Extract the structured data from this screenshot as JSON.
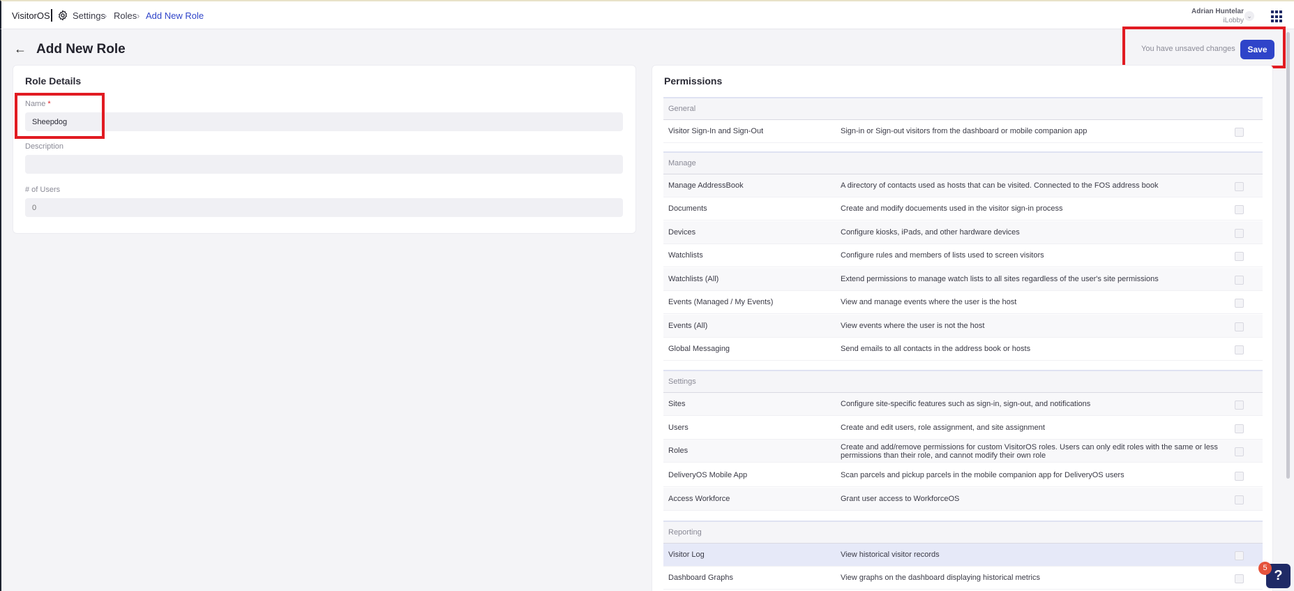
{
  "topbar": {
    "brand": "VisitorOS",
    "breadcrumb": [
      "Settings",
      "Roles",
      "Add New Role"
    ],
    "chevron": "›",
    "user_name": "Adrian Huntelar",
    "user_org": "iLobby"
  },
  "header": {
    "title": "Add New Role",
    "back_icon": "←",
    "unsaved_text": "You have unsaved changes",
    "save_label": "Save"
  },
  "role_details": {
    "title": "Role Details",
    "name_label": "Name",
    "required_mark": "*",
    "name_value": "Sheepdog",
    "description_label": "Description",
    "description_value": "",
    "users_label": "# of Users",
    "users_placeholder": "0"
  },
  "permissions": {
    "title": "Permissions",
    "groups": [
      {
        "label": "General",
        "rows": [
          {
            "name": "Visitor Sign-In and Sign-Out",
            "desc": "Sign-in or Sign-out visitors from the dashboard or mobile companion app"
          }
        ]
      },
      {
        "label": "Manage",
        "rows": [
          {
            "name": "Manage AddressBook",
            "desc": "A directory of contacts used as hosts that can be visited. Connected to the FOS address book"
          },
          {
            "name": "Documents",
            "desc": "Create and modify docuements used in the visitor sign-in process"
          },
          {
            "name": "Devices",
            "desc": "Configure kiosks, iPads, and other hardware devices"
          },
          {
            "name": "Watchlists",
            "desc": "Configure rules and members of lists used to screen visitors"
          },
          {
            "name": "Watchlists (All)",
            "desc": "Extend permissions to manage watch lists to all sites regardless of the user's site permissions"
          },
          {
            "name": "Events (Managed / My Events)",
            "desc": "View and manage events where the user is the host"
          },
          {
            "name": "Events (All)",
            "desc": "View events where the user is not the host"
          },
          {
            "name": "Global Messaging",
            "desc": "Send emails to all contacts in the address book or hosts"
          }
        ]
      },
      {
        "label": "Settings",
        "rows": [
          {
            "name": "Sites",
            "desc": "Configure site-specific features such as sign-in, sign-out, and notifications"
          },
          {
            "name": "Users",
            "desc": "Create and edit users, role assignment, and site assignment"
          },
          {
            "name": "Roles",
            "desc": "Create and add/remove permissions for custom VisitorOS roles. Users can only edit roles with the same or less permissions than their role, and cannot modify their own role"
          },
          {
            "name": "DeliveryOS Mobile App",
            "desc": "Scan parcels and pickup parcels in the mobile companion app for DeliveryOS users"
          },
          {
            "name": "Access Workforce",
            "desc": "Grant user access to WorkforceOS"
          }
        ]
      },
      {
        "label": "Reporting",
        "rows": [
          {
            "name": "Visitor Log",
            "desc": "View historical visitor records"
          },
          {
            "name": "Dashboard Graphs",
            "desc": "View graphs on the dashboard displaying historical metrics"
          }
        ]
      }
    ]
  },
  "help": {
    "icon": "?",
    "badge": "5"
  },
  "icons": {
    "settings": "gear-icon",
    "apps": "apps-grid-icon",
    "back": "arrow-left-icon",
    "help": "help-icon"
  }
}
